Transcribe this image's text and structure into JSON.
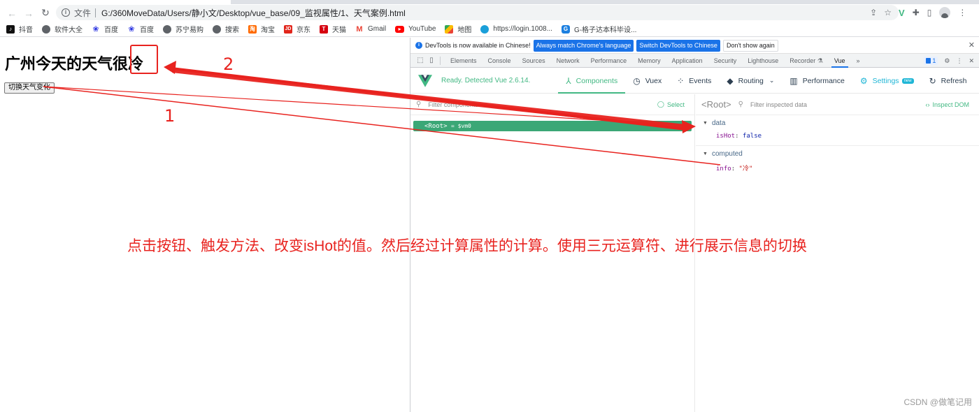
{
  "browser": {
    "url_scheme": "文件",
    "url": "G:/360MoveData/Users/静小文/Desktop/vue_base/09_监视属性/1、天气案例.html",
    "bookmarks": [
      {
        "icon": "tiktok-icon",
        "label": "抖音"
      },
      {
        "icon": "globe-icon",
        "label": "软件大全"
      },
      {
        "icon": "baidu-icon",
        "label": "百度"
      },
      {
        "icon": "baidu-icon",
        "label": "百度"
      },
      {
        "icon": "globe-icon",
        "label": "苏宁易购"
      },
      {
        "icon": "globe-icon",
        "label": "搜索"
      },
      {
        "icon": "taobao-icon",
        "label": "淘宝"
      },
      {
        "icon": "jd-icon",
        "label": "京东"
      },
      {
        "icon": "tmall-icon",
        "label": "天猫"
      },
      {
        "icon": "gmail-icon",
        "label": "Gmail"
      },
      {
        "icon": "youtube-icon",
        "label": "YouTube"
      },
      {
        "icon": "maps-icon",
        "label": "地图"
      },
      {
        "icon": "china-mobile-icon",
        "label": "https://login.1008..."
      },
      {
        "icon": "gezi-icon",
        "label": "G-格子达本科毕设..."
      }
    ]
  },
  "page": {
    "heading": "广州今天的天气很冷",
    "button_label": "切换天气变化"
  },
  "devtools": {
    "infobar": {
      "message": "DevTools is now available in Chinese!",
      "btn_match": "Always match Chrome's language",
      "btn_switch": "Switch DevTools to Chinese",
      "btn_dismiss": "Don't show again"
    },
    "tabs": [
      "Elements",
      "Console",
      "Sources",
      "Network",
      "Performance",
      "Memory",
      "Application",
      "Security",
      "Lighthouse",
      "Recorder",
      "Vue"
    ],
    "active_tab": "Vue",
    "issues_count": "1",
    "vue": {
      "status": "Ready. Detected Vue 2.6.14.",
      "nav": {
        "components": "Components",
        "vuex": "Vuex",
        "events": "Events",
        "routing": "Routing",
        "performance": "Performance",
        "settings": "Settings",
        "settings_badge": "new",
        "refresh": "Refresh"
      },
      "filter_components_placeholder": "Filter components",
      "select_label": "Select",
      "root_component": "<Root>",
      "root_vm": "= $vm0",
      "inspected_label": "<Root>",
      "filter_data_placeholder": "Filter inspected data",
      "inspect_dom_label": "Inspect DOM",
      "sections": {
        "data": {
          "title": "data",
          "key": "isHot",
          "value": "false"
        },
        "computed": {
          "title": "computed",
          "key": "info",
          "value": "\"冷\""
        }
      }
    }
  },
  "annotations": {
    "step1": "1",
    "step2": "2",
    "explanation": "点击按钮、触发方法、改变isHot的值。然后经过计算属性的计算。使用三元运算符、进行展示信息的切换",
    "color": "#e8231f"
  },
  "watermark": "CSDN @做笔记用"
}
